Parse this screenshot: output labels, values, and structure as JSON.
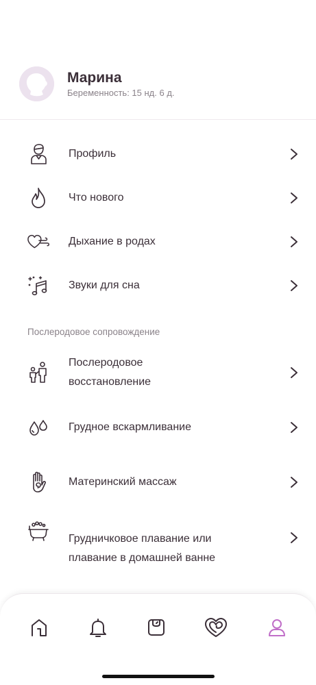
{
  "profile": {
    "name": "Марина",
    "pregnancy": "Беременность: 15 нд. 6 д."
  },
  "menu": {
    "items": [
      {
        "label": "Профиль",
        "icon": "profile-icon"
      },
      {
        "label": "Что нового",
        "icon": "flame-icon"
      },
      {
        "label": "Дыхание в родах",
        "icon": "heart-breath-icon"
      },
      {
        "label": "Звуки для сна",
        "icon": "music-note-icon"
      }
    ]
  },
  "postpartum": {
    "title": "Послеродовое сопровождение",
    "items": [
      {
        "label": "Послеродовое восстановление",
        "icon": "parent-child-icon"
      },
      {
        "label": "Грудное вскармливание",
        "icon": "milk-drops-icon"
      },
      {
        "label": "Материнский массаж",
        "icon": "hand-spiral-icon"
      },
      {
        "label": "Грудничковое плавание или плавание в домашней ванне",
        "icon": "bathtub-icon"
      }
    ]
  },
  "tabbar": {
    "tabs": [
      {
        "name": "home",
        "icon": "home-icon",
        "active": false
      },
      {
        "name": "notifications",
        "icon": "bell-icon",
        "active": false
      },
      {
        "name": "scale",
        "icon": "scale-icon",
        "active": false
      },
      {
        "name": "health",
        "icon": "heart-swirl-icon",
        "active": false
      },
      {
        "name": "profile",
        "icon": "person-icon",
        "active": true
      }
    ]
  },
  "colors": {
    "accent": "#c06ec8",
    "text": "#3b2f38",
    "muted": "#8a8289",
    "avatar_bg": "#ece2ee"
  }
}
